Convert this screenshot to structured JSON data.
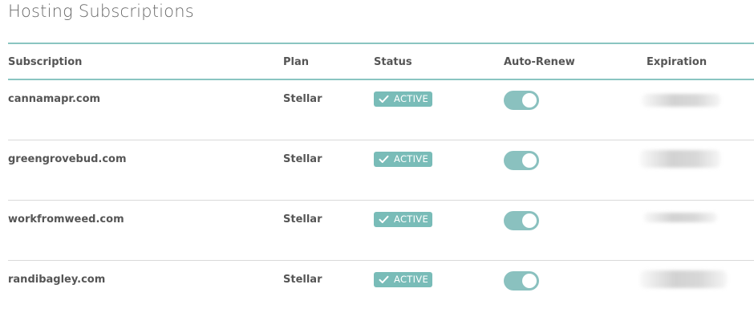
{
  "page": {
    "title": "Hosting Subscriptions"
  },
  "table": {
    "columns": {
      "subscription": "Subscription",
      "plan": "Plan",
      "status": "Status",
      "auto_renew": "Auto-Renew",
      "expiration": "Expiration"
    },
    "rows": [
      {
        "subscription": "cannamapr.com",
        "plan": "Stellar",
        "status": "ACTIVE",
        "auto_renew": true
      },
      {
        "subscription": "greengrovebud.com",
        "plan": "Stellar",
        "status": "ACTIVE",
        "auto_renew": true
      },
      {
        "subscription": "workfromweed.com",
        "plan": "Stellar",
        "status": "ACTIVE",
        "auto_renew": true
      },
      {
        "subscription": "randibagley.com",
        "plan": "Stellar",
        "status": "ACTIVE",
        "auto_renew": true
      }
    ]
  },
  "icons": {
    "status_check": "check-icon"
  },
  "colors": {
    "accent": "#8ac5c1",
    "badge_bg": "#79bcb8",
    "toggle_bg": "#8ac1bf",
    "divider": "#d9d9d9"
  }
}
